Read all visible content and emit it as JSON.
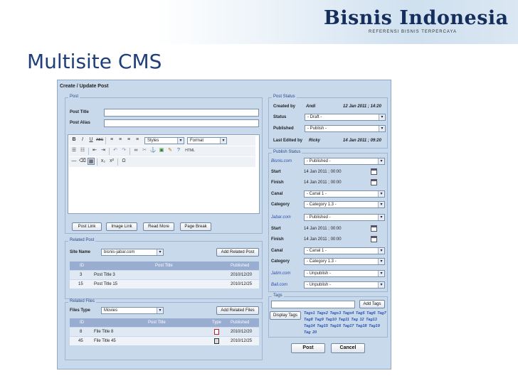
{
  "slide": {
    "title": "Multisite CMS",
    "brand": "Bisnis Indonesia",
    "brand_tagline": "REFERENSI BISNIS TERPERCAYA"
  },
  "window": {
    "title": "Create / Update Post"
  },
  "post": {
    "legend": "Post",
    "title_label": "Post Title",
    "alias_label": "Post Alias",
    "title_value": "",
    "alias_value": "",
    "toolbar": {
      "styles": "Styles",
      "format": "Format",
      "row1_icons": [
        "bold-icon",
        "italic-icon",
        "underline-icon",
        "strikethrough-icon",
        "align-left-icon",
        "align-center-icon",
        "align-right-icon",
        "align-justify-icon"
      ],
      "row2_icons": [
        "bullet-list-icon",
        "numbered-list-icon",
        "outdent-icon",
        "indent-icon",
        "undo-icon",
        "redo-icon",
        "link-icon",
        "unlink-icon",
        "anchor-icon",
        "image-icon",
        "cleanup-icon",
        "help-icon",
        "html-icon"
      ],
      "row3_icons": [
        "horizontal-rule-icon",
        "remove-format-icon",
        "visual-aid-icon",
        "subscript-icon",
        "superscript-icon",
        "special-char-icon"
      ],
      "html_label": "HTML"
    },
    "buttons": {
      "post_link": "Post Link",
      "image_link": "Image Link",
      "read_more": "Read More",
      "page_break": "Page Break"
    }
  },
  "related_post": {
    "legend": "Related Post",
    "site_label": "Site Name",
    "site_value": "bisnis-jabar.com",
    "add_button": "Add Related Post",
    "columns": [
      "ID",
      "Post Title",
      "Published"
    ],
    "rows": [
      {
        "id": "3",
        "title": "Post Title 3",
        "published": "2010/12/20"
      },
      {
        "id": "15",
        "title": "Post Title 15",
        "published": "2010/12/25"
      }
    ]
  },
  "related_files": {
    "legend": "Related Files",
    "type_label": "Files Type",
    "type_value": "Movies",
    "add_button": "Add Related Files",
    "columns": [
      "ID",
      "Post Title",
      "Type",
      "Published"
    ],
    "rows": [
      {
        "id": "8",
        "title": "File Title 8",
        "type_icon": "pdf-file-icon",
        "published": "2010/12/20"
      },
      {
        "id": "45",
        "title": "File Title 45",
        "type_icon": "doc-file-icon",
        "published": "2010/12/25"
      }
    ]
  },
  "post_status": {
    "legend": "Post Status",
    "created_by_label": "Created by",
    "created_by_value": "Andi",
    "created_at": "12 Jan 2011 ; 14:20",
    "status_label": "Status",
    "status_value": "- Draft -",
    "published_label": "Published",
    "published_value": "- Publish -",
    "last_edited_label": "Last Edited by",
    "last_edited_value": "Ricky",
    "last_edited_at": "14 Jan 2011 ; 09:20"
  },
  "publish_status": {
    "legend": "Publish Status",
    "sites": [
      {
        "name": "Bisnis.com",
        "status": "- Published -",
        "start_label": "Start",
        "start": "14 Jan 2011 ; 00:00",
        "finish_label": "Finish",
        "finish": "14 Jan 2011 ; 00:00",
        "canal_label": "Canal",
        "canal": "- Canal 1 -",
        "category_label": "Category",
        "category": "- Category 1.3 -"
      },
      {
        "name": "Jabar.com",
        "status": "- Published -",
        "start_label": "Start",
        "start": "14 Jan 2011 ; 00:00",
        "finish_label": "Finish",
        "finish": "14 Jan 2011 ; 00:00",
        "canal_label": "Canal",
        "canal": "- Canal 1 -",
        "category_label": "Category",
        "category": "- Category 1.3 -"
      },
      {
        "name": "Jatim.com",
        "status": "- Unpublish -"
      },
      {
        "name": "Bali.com",
        "status": "- Unpublish -"
      }
    ]
  },
  "tags": {
    "legend": "Tags",
    "add_button": "Add Tags",
    "display_button": "Display Tags",
    "list": "Tags1 Tags2 Tags3 Tags4 Tag5 Tag6 Tag7 Tag8 Tag9 Tag10 Tag11 Tag 12 Tag13 Tag14 Tag15 Tag16 Tag17 Tag18 Tag19 Tag 20"
  },
  "actions": {
    "post": "Post",
    "cancel": "Cancel"
  }
}
